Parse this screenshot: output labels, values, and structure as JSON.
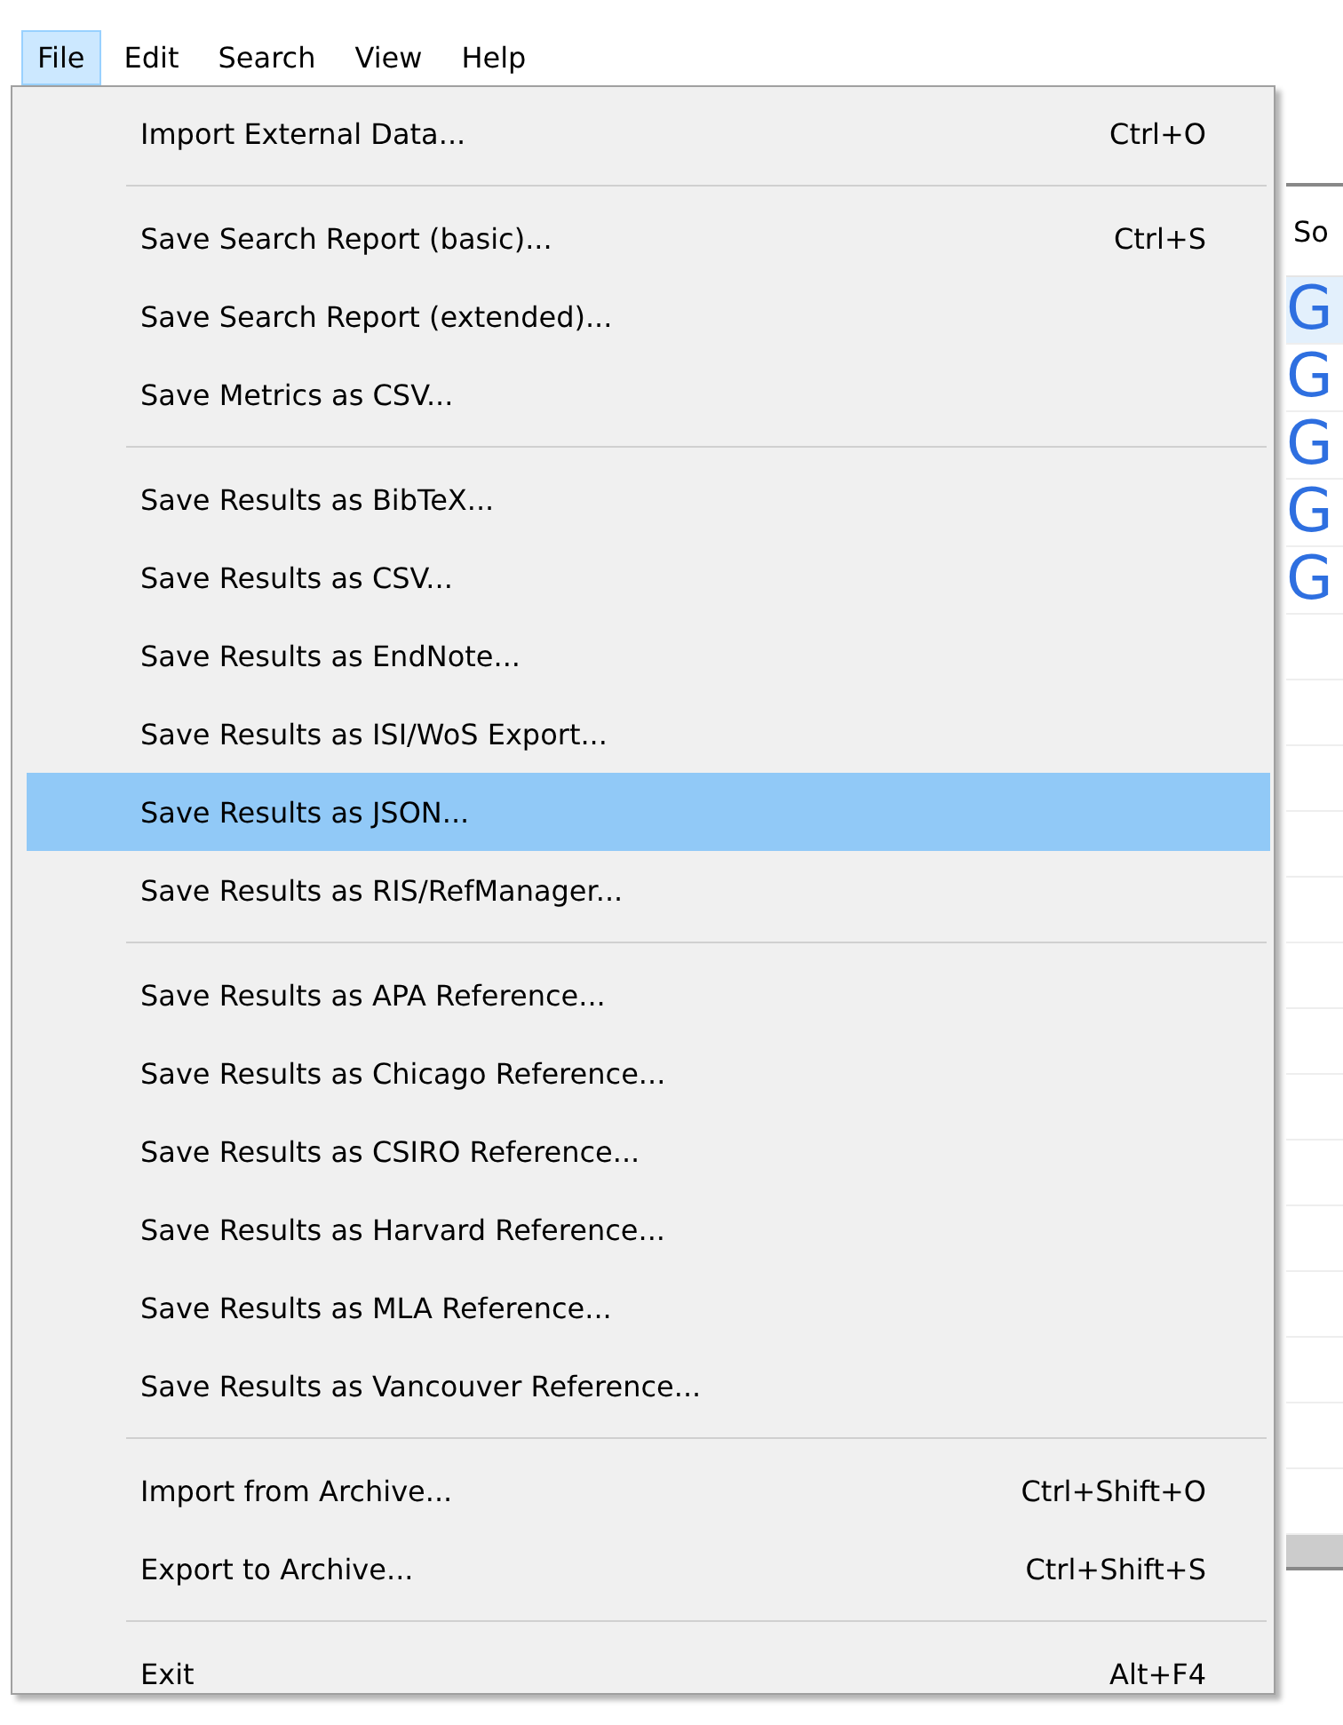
{
  "menubar": [
    {
      "label": "File",
      "selected": true
    },
    {
      "label": "Edit",
      "selected": false
    },
    {
      "label": "Search",
      "selected": false
    },
    {
      "label": "View",
      "selected": false
    },
    {
      "label": "Help",
      "selected": false
    }
  ],
  "file_menu": {
    "groups": [
      [
        {
          "label": "Import External Data...",
          "shortcut": "Ctrl+O",
          "selected": false
        }
      ],
      [
        {
          "label": "Save Search Report (basic)...",
          "shortcut": "Ctrl+S",
          "selected": false
        },
        {
          "label": "Save Search Report (extended)...",
          "selected": false
        },
        {
          "label": "Save Metrics as CSV...",
          "selected": false
        }
      ],
      [
        {
          "label": "Save Results as BibTeX...",
          "selected": false
        },
        {
          "label": "Save Results as CSV...",
          "selected": false
        },
        {
          "label": "Save Results as EndNote...",
          "selected": false
        },
        {
          "label": "Save Results as ISI/WoS Export...",
          "selected": false
        },
        {
          "label": "Save Results as JSON...",
          "selected": true
        },
        {
          "label": "Save Results as RIS/RefManager...",
          "selected": false
        }
      ],
      [
        {
          "label": "Save Results as APA Reference...",
          "selected": false
        },
        {
          "label": "Save Results as Chicago Reference...",
          "selected": false
        },
        {
          "label": "Save Results as CSIRO Reference...",
          "selected": false
        },
        {
          "label": "Save Results as Harvard Reference...",
          "selected": false
        },
        {
          "label": "Save Results as MLA Reference...",
          "selected": false
        },
        {
          "label": "Save Results as Vancouver Reference...",
          "selected": false
        }
      ],
      [
        {
          "label": "Import from Archive...",
          "shortcut": "Ctrl+Shift+O",
          "selected": false
        },
        {
          "label": "Export to Archive...",
          "shortcut": "Ctrl+Shift+S",
          "selected": false
        }
      ],
      [
        {
          "label": "Exit",
          "shortcut": "Alt+F4",
          "selected": false
        }
      ]
    ]
  },
  "results_table": {
    "column_1_header": "So",
    "rows": [
      {
        "source": "G",
        "selected": true
      },
      {
        "source": "G",
        "selected": false
      },
      {
        "source": "G",
        "selected": false
      },
      {
        "source": "G",
        "selected": false
      },
      {
        "source": "G",
        "selected": false
      }
    ]
  }
}
